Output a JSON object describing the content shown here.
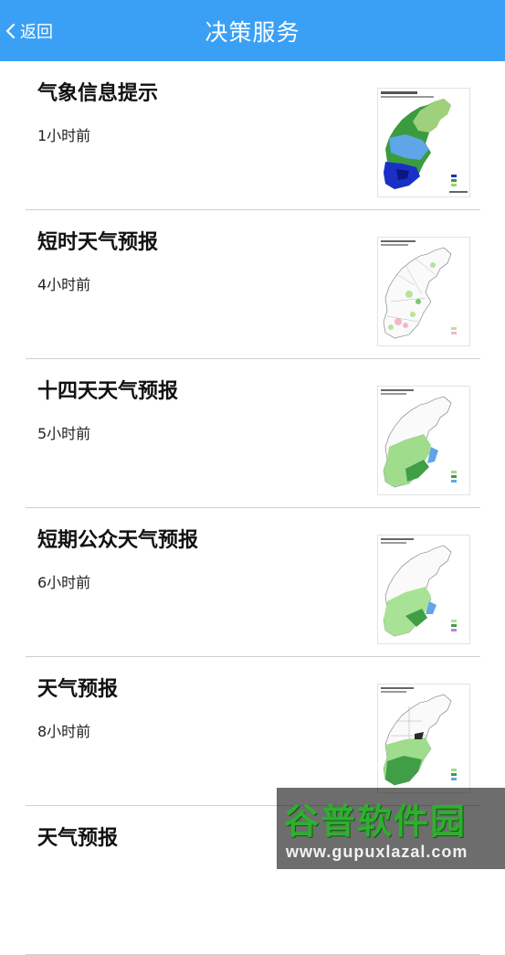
{
  "header": {
    "back_label": "返回",
    "title": "决策服务",
    "bg_color": "#3aa0f5"
  },
  "items": [
    {
      "title": "气象信息提示",
      "time": "1小时前",
      "thumb_style": "rain-blue"
    },
    {
      "title": "短时天气预报",
      "time": "4小时前",
      "thumb_style": "sparse-green-pink"
    },
    {
      "title": "十四天天气预报",
      "time": "5小时前",
      "thumb_style": "green-south"
    },
    {
      "title": "短期公众天气预报",
      "time": "6小时前",
      "thumb_style": "green-south"
    },
    {
      "title": "天气预报",
      "time": "8小时前",
      "thumb_style": "green-dense"
    },
    {
      "title": "天气预报",
      "time": "",
      "thumb_style": "none"
    }
  ],
  "watermark": {
    "logo": "谷普软件园",
    "url": "www.gupuxlazal.com"
  }
}
